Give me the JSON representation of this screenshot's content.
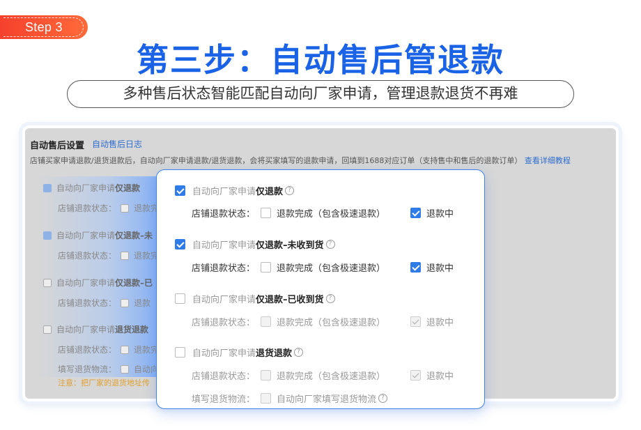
{
  "step_badge": "Step 3",
  "title": "第三步：自动售后管退款",
  "subtitle": "多种售后状态智能匹配自动向厂家申请，管理退款退货不再难",
  "background_panel": {
    "title": "自动售后设置",
    "log_link": "自动售后日志",
    "description": "店铺买家申请退款/退货退款后，自动向厂家申请退款/退货退款，会将买家填写的退款申请，回填到1688对应订单（支持售中和售后的退款订单）",
    "tutorial_link": "查看详细教程",
    "rows": [
      {
        "prefix": "自动向厂家申请",
        "strong": "仅退款",
        "checked": true
      },
      {
        "prefix": "店铺退款状态：",
        "tail": "退款完"
      },
      {
        "prefix": "自动向厂家申请",
        "strong": "仅退款–未",
        "checked": true
      },
      {
        "prefix": "店铺退款状态：",
        "tail": "退款完"
      },
      {
        "prefix": "自动向厂家申请",
        "strong": "仅退款–已",
        "checked": false
      },
      {
        "prefix": "店铺退款状态：",
        "tail": "退款"
      },
      {
        "prefix": "自动向厂家申请",
        "strong": "退货退款",
        "checked": false
      },
      {
        "prefix": "店铺退款状态：",
        "tail": "退款完"
      },
      {
        "prefix": "填写退货物流：",
        "tail": "自动向"
      }
    ],
    "note": "注意：把厂家的退货地址传"
  },
  "card": {
    "sections": [
      {
        "prefix": "自动向厂家申请",
        "strong": "仅退款",
        "checked": true,
        "help": "?",
        "status_label": "店铺退款状态：",
        "option_a": "退款完成（包含极速退款）",
        "option_a_checked": false,
        "option_b": "退款中",
        "option_b_checked": true
      },
      {
        "prefix": "自动向厂家申请",
        "strong": "仅退款–未收到货",
        "checked": true,
        "help": "?",
        "status_label": "店铺退款状态：",
        "option_a": "退款完成（包含极速退款）",
        "option_a_checked": false,
        "option_b": "退款中",
        "option_b_checked": true
      },
      {
        "prefix": "自动向厂家申请",
        "strong": "仅退款–已收到货",
        "checked": false,
        "help": "?",
        "status_label": "店铺退款状态：",
        "option_a": "退款完成（包含极速退款）",
        "option_a_checked": false,
        "option_b": "退款中",
        "option_b_checked": true
      },
      {
        "prefix": "自动向厂家申请",
        "strong": "退货退款",
        "checked": false,
        "help": "?",
        "status_label": "店铺退款状态：",
        "option_a": "退款完成（包含极速退款）",
        "option_a_checked": false,
        "option_b": "退款中",
        "option_b_checked": true,
        "logistics_label": "填写退货物流：",
        "logistics_option": "自动向厂家填写退货物流"
      }
    ]
  },
  "colors": {
    "title_blue": "#1a63e6",
    "badge_red": "#f6412c",
    "checkbox_blue": "#2f7be8",
    "link_blue": "#2f6ccf",
    "note_orange": "#e0a030"
  }
}
